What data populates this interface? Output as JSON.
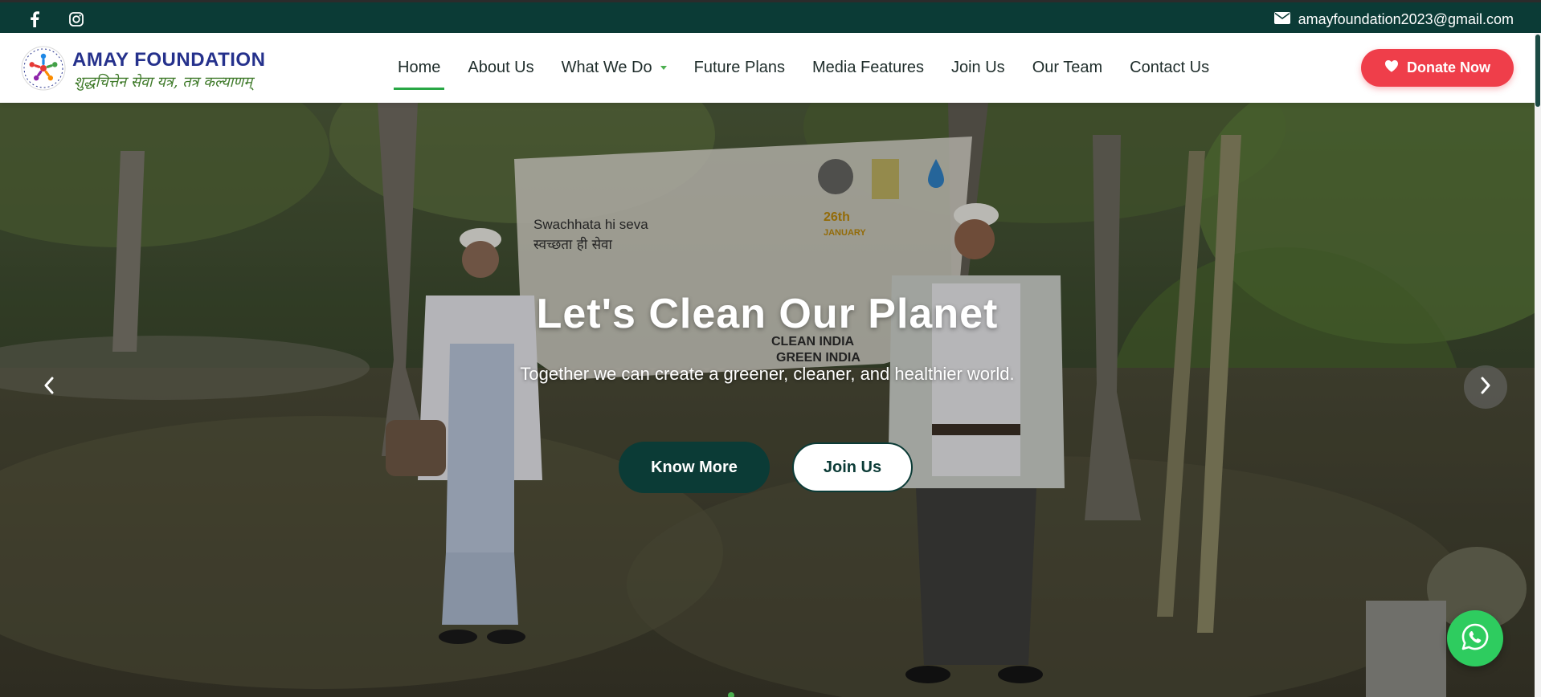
{
  "topbar": {
    "social": [
      "facebook-icon",
      "instagram-icon"
    ],
    "email": "amayfoundation2023@gmail.com"
  },
  "brand": {
    "name": "AMAY FOUNDATION",
    "tagline": "शुद्धचित्तेन सेवा यत्र, तत्र कल्याणम्"
  },
  "nav": {
    "items": [
      {
        "label": "Home",
        "active": true
      },
      {
        "label": "About Us"
      },
      {
        "label": "What We Do",
        "dropdown": true
      },
      {
        "label": "Future Plans"
      },
      {
        "label": "Media Features"
      },
      {
        "label": "Join Us"
      },
      {
        "label": "Our Team"
      },
      {
        "label": "Contact Us"
      }
    ],
    "donate_label": "Donate Now"
  },
  "hero": {
    "title": "Let's Clean Our Planet",
    "subtitle": "Together we can create a greener, cleaner, and healthier world.",
    "primary_cta": "Know More",
    "secondary_cta": "Join Us",
    "banner_text_1": "Swachhata hi seva",
    "banner_text_2": "स्वच्छता ही सेवा",
    "banner_text_3": "CLEAN INDIA",
    "banner_text_4": "GREEN INDIA",
    "banner_date_1": "26th",
    "banner_date_2": "JANUARY"
  },
  "colors": {
    "topbar": "#0b3b36",
    "brand_blue": "#25318c",
    "accent_green": "#28a745",
    "donate_red": "#ef3e4a",
    "whatsapp_green": "#2ecc5f"
  }
}
